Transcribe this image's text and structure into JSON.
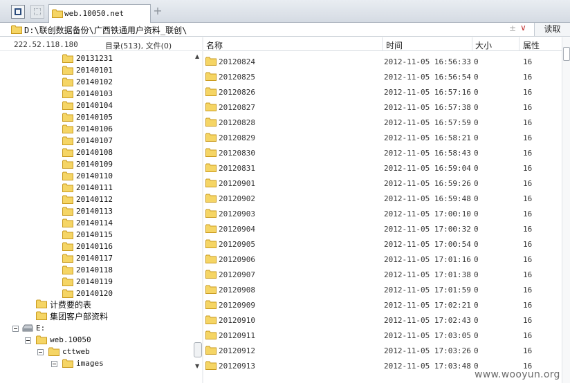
{
  "tab": {
    "label": "web.10050.net",
    "add_symbol": "+"
  },
  "pathbar": {
    "path": "D:\\联创数据备份\\广西铁通用户资料_联创\\",
    "star": "±",
    "dropdown": "∨",
    "read_label": "读取"
  },
  "left_header": {
    "ip": "222.52.118.180",
    "counts": "目录(513), 文件(0)"
  },
  "tree": {
    "folders": [
      "20131231",
      "20140101",
      "20140102",
      "20140103",
      "20140104",
      "20140105",
      "20140106",
      "20140107",
      "20140108",
      "20140109",
      "20140110",
      "20140111",
      "20140112",
      "20140113",
      "20140114",
      "20140115",
      "20140116",
      "20140117",
      "20140118",
      "20140119",
      "20140120"
    ],
    "extra_folders": [
      "计费要的表",
      "集团客户部资料"
    ],
    "drive": "E:",
    "web_node": "web.10050",
    "cttweb_node": "cttweb",
    "images_node": "images"
  },
  "columns": {
    "name": "名称",
    "time": "时间",
    "size": "大小",
    "attr": "属性"
  },
  "files": [
    {
      "name": "20120824",
      "time": "2012-11-05 16:56:33",
      "size": "0",
      "attr": "16"
    },
    {
      "name": "20120825",
      "time": "2012-11-05 16:56:54",
      "size": "0",
      "attr": "16"
    },
    {
      "name": "20120826",
      "time": "2012-11-05 16:57:16",
      "size": "0",
      "attr": "16"
    },
    {
      "name": "20120827",
      "time": "2012-11-05 16:57:38",
      "size": "0",
      "attr": "16"
    },
    {
      "name": "20120828",
      "time": "2012-11-05 16:57:59",
      "size": "0",
      "attr": "16"
    },
    {
      "name": "20120829",
      "time": "2012-11-05 16:58:21",
      "size": "0",
      "attr": "16"
    },
    {
      "name": "20120830",
      "time": "2012-11-05 16:58:43",
      "size": "0",
      "attr": "16"
    },
    {
      "name": "20120831",
      "time": "2012-11-05 16:59:04",
      "size": "0",
      "attr": "16"
    },
    {
      "name": "20120901",
      "time": "2012-11-05 16:59:26",
      "size": "0",
      "attr": "16"
    },
    {
      "name": "20120902",
      "time": "2012-11-05 16:59:48",
      "size": "0",
      "attr": "16"
    },
    {
      "name": "20120903",
      "time": "2012-11-05 17:00:10",
      "size": "0",
      "attr": "16"
    },
    {
      "name": "20120904",
      "time": "2012-11-05 17:00:32",
      "size": "0",
      "attr": "16"
    },
    {
      "name": "20120905",
      "time": "2012-11-05 17:00:54",
      "size": "0",
      "attr": "16"
    },
    {
      "name": "20120906",
      "time": "2012-11-05 17:01:16",
      "size": "0",
      "attr": "16"
    },
    {
      "name": "20120907",
      "time": "2012-11-05 17:01:38",
      "size": "0",
      "attr": "16"
    },
    {
      "name": "20120908",
      "time": "2012-11-05 17:01:59",
      "size": "0",
      "attr": "16"
    },
    {
      "name": "20120909",
      "time": "2012-11-05 17:02:21",
      "size": "0",
      "attr": "16"
    },
    {
      "name": "20120910",
      "time": "2012-11-05 17:02:43",
      "size": "0",
      "attr": "16"
    },
    {
      "name": "20120911",
      "time": "2012-11-05 17:03:05",
      "size": "0",
      "attr": "16"
    },
    {
      "name": "20120912",
      "time": "2012-11-05 17:03:26",
      "size": "0",
      "attr": "16"
    },
    {
      "name": "20120913",
      "time": "2012-11-05 17:03:48",
      "size": "0",
      "attr": "16"
    }
  ],
  "watermark": "www.wooyun.org",
  "icons": {
    "folder": "folder-icon",
    "drive": "drive-icon",
    "expander": "collapse-icon"
  },
  "colors": {
    "folder_fill": "#f5d565",
    "folder_edge": "#c99a1e"
  }
}
